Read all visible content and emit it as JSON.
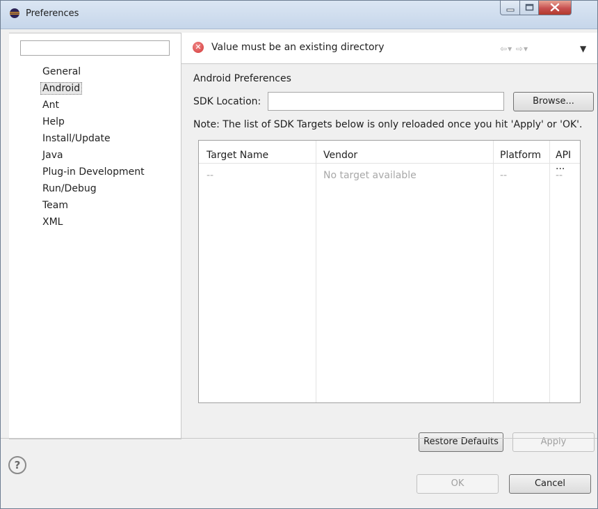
{
  "window": {
    "title": "Preferences",
    "icon": "eclipse-icon"
  },
  "sidebar": {
    "filter_value": "",
    "items": [
      {
        "label": "General"
      },
      {
        "label": "Android",
        "selected": true
      },
      {
        "label": "Ant"
      },
      {
        "label": "Help"
      },
      {
        "label": "Install/Update"
      },
      {
        "label": "Java"
      },
      {
        "label": "Plug-in Development"
      },
      {
        "label": "Run/Debug"
      },
      {
        "label": "Team"
      },
      {
        "label": "XML"
      }
    ]
  },
  "message": {
    "text": "Value must be an existing directory",
    "icon": "error-icon"
  },
  "page": {
    "title": "Android Preferences",
    "sdk_label": "SDK Location:",
    "sdk_value": "",
    "browse_label": "Browse...",
    "note": "Note: The list of SDK Targets below is only reloaded once you hit 'Apply' or 'OK'."
  },
  "table": {
    "columns": [
      "Target Name",
      "Vendor",
      "Platform",
      "API ..."
    ],
    "rows": [
      [
        "--",
        "No target available",
        "--",
        "--"
      ]
    ]
  },
  "buttons": {
    "restore_defaults": "Restore Defaults",
    "apply": "Apply",
    "ok": "OK",
    "cancel": "Cancel"
  },
  "footer": {
    "help_icon": "help-icon"
  }
}
